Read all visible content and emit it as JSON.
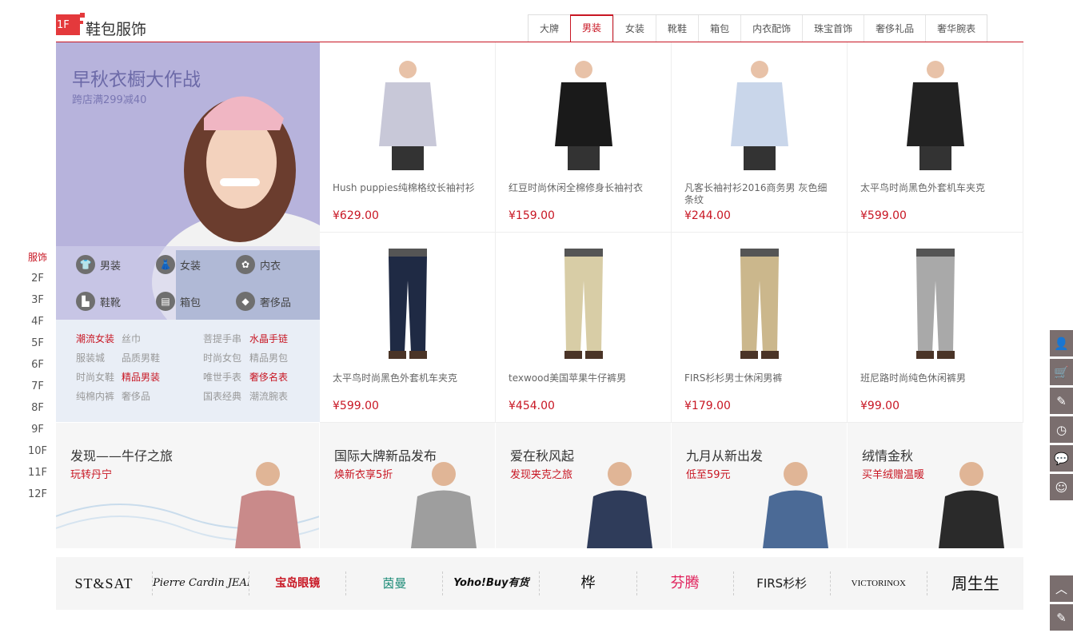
{
  "floor": {
    "badge": "1F",
    "title": "鞋包服饰"
  },
  "tabs": [
    "大牌",
    "男装",
    "女装",
    "靴鞋",
    "箱包",
    "内衣配饰",
    "珠宝首饰",
    "奢侈礼品",
    "奢华腕表"
  ],
  "active_tab": "男装",
  "promo": {
    "title": "早秋衣橱大作战",
    "subtitle": "跨店满299减40",
    "categories": [
      {
        "label": "男装",
        "icon": "shirt-icon"
      },
      {
        "label": "女装",
        "icon": "dress-icon"
      },
      {
        "label": "内衣",
        "icon": "bra-icon"
      },
      {
        "label": "鞋靴",
        "icon": "boot-icon"
      },
      {
        "label": "箱包",
        "icon": "bag-icon"
      },
      {
        "label": "奢侈品",
        "icon": "diamond-icon"
      }
    ],
    "links": [
      [
        "潮流女装",
        "丝巾",
        "菩提手串",
        "水晶手链"
      ],
      [
        "服装城",
        "品质男鞋",
        "时尚女包",
        "精品男包"
      ],
      [
        "时尚女鞋",
        "精品男装",
        "唯世手表",
        "奢侈名表"
      ],
      [
        "纯棉内裤",
        "奢侈品",
        "国表经典",
        "潮流腕表"
      ]
    ],
    "hot_links": [
      "潮流女装",
      "水晶手链",
      "精品男装",
      "奢侈名表"
    ]
  },
  "products": [
    {
      "name": "Hush puppies纯棉格纹长袖衬衫",
      "price": "¥629.00",
      "kind": "shirt",
      "color": "#c8c8d8"
    },
    {
      "name": "红豆时尚休闲全棉修身长袖衬衣",
      "price": "¥159.00",
      "kind": "shirt",
      "color": "#1a1a1a"
    },
    {
      "name": "凡客长袖衬衫2016商务男 灰色细条纹",
      "price": "¥244.00",
      "kind": "shirt",
      "color": "#c9d6ea"
    },
    {
      "name": "太平鸟时尚黑色外套机车夹克",
      "price": "¥599.00",
      "kind": "shirt",
      "color": "#222222"
    },
    {
      "name": "太平鸟时尚黑色外套机车夹克",
      "price": "¥599.00",
      "kind": "pants",
      "color": "#1f2a44"
    },
    {
      "name": "texwood美国苹果牛仔裤男",
      "price": "¥454.00",
      "kind": "pants",
      "color": "#d8cda6"
    },
    {
      "name": "FIRS杉杉男士休闲男裤",
      "price": "¥179.00",
      "kind": "pants",
      "color": "#cbb78c"
    },
    {
      "name": "班尼路时尚纯色休闲裤男",
      "price": "¥99.00",
      "kind": "pants",
      "color": "#a9a9a9"
    }
  ],
  "banners": [
    {
      "title": "发现——牛仔之旅",
      "subtitle": "玩转丹宁",
      "color": "#c98a8a"
    },
    {
      "title": "国际大牌新品发布",
      "subtitle": "焕新衣享5折",
      "color": "#9e9e9e"
    },
    {
      "title": "爱在秋风起",
      "subtitle": "发现夹克之旅",
      "color": "#2f3c5a"
    },
    {
      "title": "九月从新出发",
      "subtitle": "低至59元",
      "color": "#4b6a96"
    },
    {
      "title": "绒情金秋",
      "subtitle": "买羊绒赠温暖",
      "color": "#2a2a2a"
    }
  ],
  "brands": [
    "ST&SAT",
    "Pierre Cardin JEANS",
    "宝岛眼镜",
    "茵曼",
    "Yoho!Buy有货",
    "桦",
    "芬腾",
    "FIRS杉杉",
    "VICTORINOX",
    "周生生"
  ],
  "floor_nav": [
    "服饰",
    "2F",
    "3F",
    "4F",
    "5F",
    "6F",
    "7F",
    "8F",
    "9F",
    "10F",
    "11F",
    "12F"
  ],
  "floor_nav_active": "服饰",
  "toolbar": [
    "user-icon",
    "cart-icon",
    "edit-icon",
    "history-icon",
    "chat-icon",
    "service-icon"
  ],
  "colors": {
    "brand_red": "#c81623",
    "promo_bg": "#b7b3dc",
    "links_bg": "#e9eef6",
    "toolbar_bg": "#7a6e6e"
  }
}
